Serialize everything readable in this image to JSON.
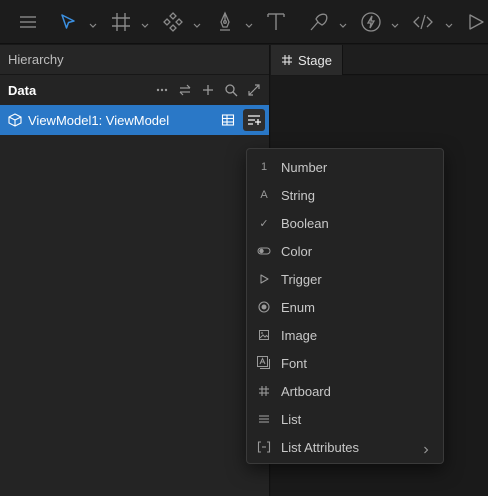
{
  "toolbar": {
    "tools": [
      {
        "icon": "hamburger-menu-icon"
      },
      {
        "icon": "select-arrow-icon",
        "active": true
      },
      {
        "icon": "frame-hash-icon"
      },
      {
        "icon": "component-diamonds-icon"
      },
      {
        "icon": "pen-tool-icon"
      },
      {
        "icon": "text-tool-icon"
      },
      {
        "icon": "bone-tool-icon"
      },
      {
        "icon": "lightning-icon"
      },
      {
        "icon": "code-icon"
      },
      {
        "icon": "play-icon"
      }
    ],
    "accent_color": "#3b8fe0"
  },
  "hierarchy": {
    "title": "Hierarchy",
    "data_section": {
      "title": "Data",
      "actions": [
        "more-icon",
        "swap-icon",
        "add-icon",
        "search-icon",
        "expand-icon"
      ]
    },
    "view_model": {
      "label": "ViewModel1: ViewModel",
      "selected_color": "#2a78c7"
    }
  },
  "stage": {
    "tab_label": "Stage"
  },
  "add_property_menu": {
    "items": [
      {
        "label": "Number",
        "icon": "number-icon",
        "glyph": "1"
      },
      {
        "label": "String",
        "icon": "string-icon",
        "glyph": "A"
      },
      {
        "label": "Boolean",
        "icon": "checkmark-icon",
        "glyph": "✓"
      },
      {
        "label": "Color",
        "icon": "color-swatch-icon"
      },
      {
        "label": "Trigger",
        "icon": "trigger-play-icon"
      },
      {
        "label": "Enum",
        "icon": "enum-radio-icon"
      },
      {
        "label": "Image",
        "icon": "image-icon"
      },
      {
        "label": "Font",
        "icon": "font-icon"
      },
      {
        "label": "Artboard",
        "icon": "artboard-hash-icon"
      },
      {
        "label": "List",
        "icon": "list-lines-icon"
      },
      {
        "label": "List Attributes",
        "icon": "list-attributes-bracket-icon",
        "submenu": true
      }
    ]
  }
}
